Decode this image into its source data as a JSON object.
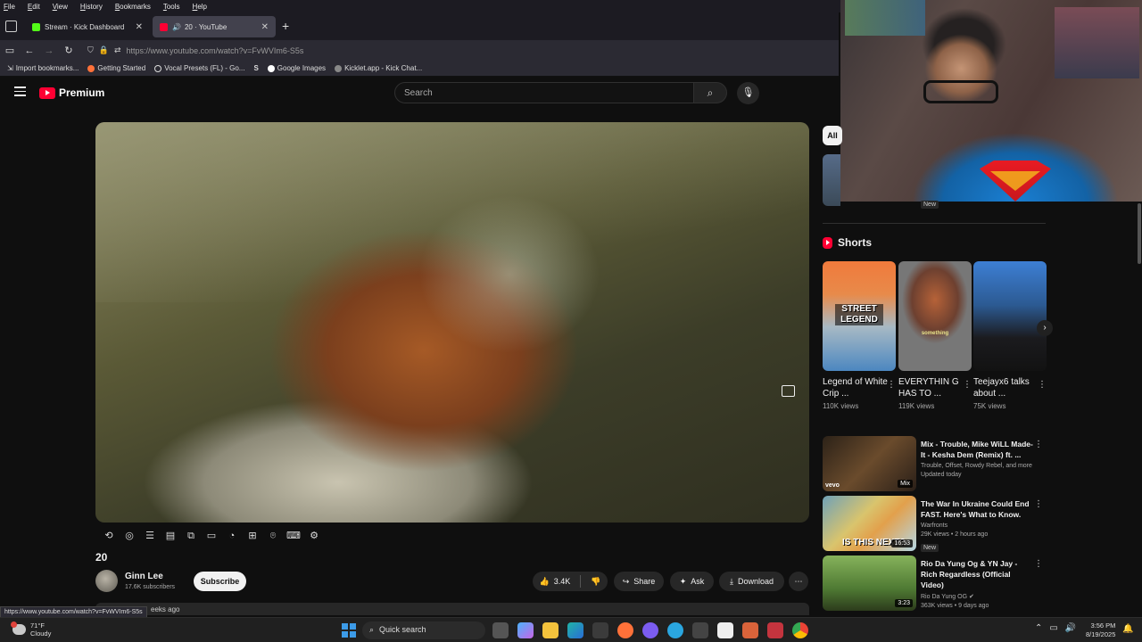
{
  "browser": {
    "menu": [
      "File",
      "Edit",
      "View",
      "History",
      "Bookmarks",
      "Tools",
      "Help"
    ],
    "tabs": [
      {
        "title": "Stream · Kick Dashboard",
        "favicon_color": "#53fc18"
      },
      {
        "title": "20 · YouTube",
        "favicon_color": "#ff0033"
      }
    ],
    "url": "https://www.youtube.com/watch?v=FvWVIm6-S5s",
    "bookmarks": [
      "Import bookmarks...",
      "Getting Started",
      "Vocal Presets (FL) - Go...",
      "Google Images",
      "Kicklet.app - Kick Chat..."
    ],
    "status_url": "https://www.youtube.com/watch?v=FvWVIm6-S5s"
  },
  "youtube": {
    "logo_text": "Premium",
    "search_placeholder": "Search",
    "video": {
      "title": "20",
      "channel": "Ginn Lee",
      "subscribers": "17.6K subscribers",
      "subscribe_label": "Subscribe",
      "likes": "3.4K",
      "share_label": "Share",
      "ask_label": "Ask",
      "download_label": "Download",
      "date_partial": "eeks ago"
    },
    "sidebar": {
      "chip_all": "All",
      "new_badge": "New",
      "shorts_title": "Shorts",
      "shorts": [
        {
          "title": "Legend of White Crip ...",
          "views": "110K views",
          "thumb_text": "STREET LEGEND"
        },
        {
          "title": "EVERYTHIN G HAS TO ...",
          "views": "119K views",
          "thumb_text": "something"
        },
        {
          "title": "Teejayx6 talks about ...",
          "views": "75K views",
          "thumb_text": ""
        }
      ],
      "recommended": [
        {
          "title": "Mix - Trouble, Mike WiLL Made-It - Kesha Dem (Remix) ft. ...",
          "channel": "Trouble, Offset, Rowdy Rebel, and more",
          "meta": "Updated today",
          "badge": "",
          "duration": "Mix"
        },
        {
          "title": "The War In Ukraine Could End FAST. Here's What to Know.",
          "channel": "Warfronts",
          "meta": "29K views • 2 hours ago",
          "badge": "New",
          "duration": "16:53",
          "thumb_text": "IS THIS NEXT?"
        },
        {
          "title": "Rio Da Yung Og & YN Jay - Rich Regardless (Official Video)",
          "channel": "Rio Da Yung OG",
          "meta": "363K views • 9 days ago",
          "badge": "",
          "duration": "3:23"
        }
      ]
    }
  },
  "taskbar": {
    "temp": "71°F",
    "condition": "Cloudy",
    "search_label": "Quick search",
    "time": "3:56 PM",
    "date": "8/19/2025"
  }
}
